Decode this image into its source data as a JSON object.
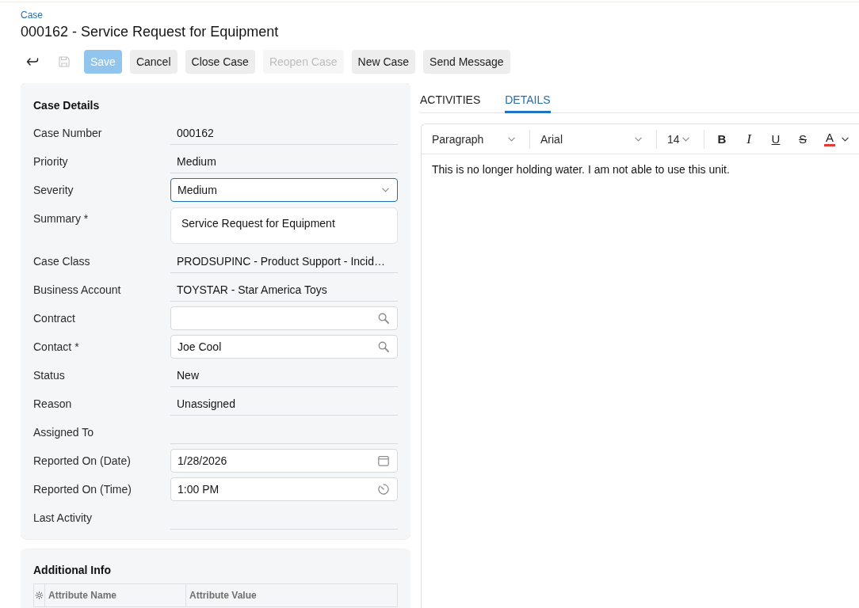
{
  "breadcrumb": "Case",
  "title": "000162 - Service Request for Equipment",
  "toolbar": {
    "icon_buttons": [
      {
        "kind": "back",
        "disabled": false
      },
      {
        "kind": "save",
        "disabled": true
      }
    ],
    "buttons": [
      {
        "label": "Save",
        "kind": "primary",
        "disabled": true
      },
      {
        "label": "Cancel",
        "kind": "secondary",
        "disabled": false
      },
      {
        "label": "Close Case",
        "kind": "secondary",
        "disabled": false
      },
      {
        "label": "Reopen Case",
        "kind": "secondary",
        "disabled": true
      },
      {
        "label": "New Case",
        "kind": "secondary",
        "disabled": false
      },
      {
        "label": "Send Message",
        "kind": "secondary",
        "disabled": false
      }
    ]
  },
  "case_details": {
    "title": "Case Details",
    "fields": [
      {
        "kind": "readonly",
        "label": "Case Number",
        "value": "000162",
        "focused": false
      },
      {
        "kind": "readonly",
        "label": "Priority",
        "value": "Medium",
        "focused": false
      },
      {
        "kind": "select",
        "label": "Severity",
        "value": "Medium",
        "focused": true
      },
      {
        "kind": "textarea",
        "label": "Summary *",
        "value": "Service Request for Equipment",
        "focused": false
      },
      {
        "kind": "readonly",
        "label": "Case Class",
        "value": "PRODSUPINC - Product Support - Incid…",
        "focused": false
      },
      {
        "kind": "readonly",
        "label": "Business Account",
        "value": "TOYSTAR - Star America Toys",
        "focused": false
      },
      {
        "kind": "lookup",
        "label": "Contract",
        "focused": false
      },
      {
        "kind": "lookup",
        "label": "Contact *",
        "value": "Joe Cool",
        "focused": false
      },
      {
        "kind": "readonly",
        "label": "Status",
        "value": "New",
        "focused": false
      },
      {
        "kind": "readonly",
        "label": "Reason",
        "value": "Unassigned",
        "focused": false
      },
      {
        "kind": "readonly",
        "label": "Assigned To",
        "focused": false
      },
      {
        "kind": "date",
        "label": "Reported On (Date)",
        "value": "1/28/2026",
        "focused": false
      },
      {
        "kind": "time",
        "label": "Reported On (Time)",
        "value": "1:00 PM",
        "focused": false
      },
      {
        "kind": "readonly",
        "label": "Last Activity",
        "focused": false
      }
    ]
  },
  "additional_info": {
    "title": "Additional Info",
    "columns": [
      "Attribute Name",
      "Attribute Value"
    ]
  },
  "tabs": [
    {
      "label": "ACTIVITIES",
      "selected": false
    },
    {
      "label": "DETAILS",
      "selected": true
    }
  ],
  "editor": {
    "dropdowns": [
      {
        "kind": "block_format",
        "value": "Paragraph"
      },
      {
        "kind": "font",
        "value": "Arial"
      },
      {
        "kind": "size",
        "value": "14"
      }
    ],
    "format_buttons": [
      {
        "kind": "bold",
        "label": "B"
      },
      {
        "kind": "italic",
        "label": "I"
      },
      {
        "kind": "underline",
        "label": "U"
      },
      {
        "kind": "strikethrough",
        "label": "S"
      },
      {
        "kind": "text_color",
        "label": "A",
        "color": "#e53935"
      }
    ],
    "text": "This is no longer holding water. I am not able to use this unit."
  }
}
